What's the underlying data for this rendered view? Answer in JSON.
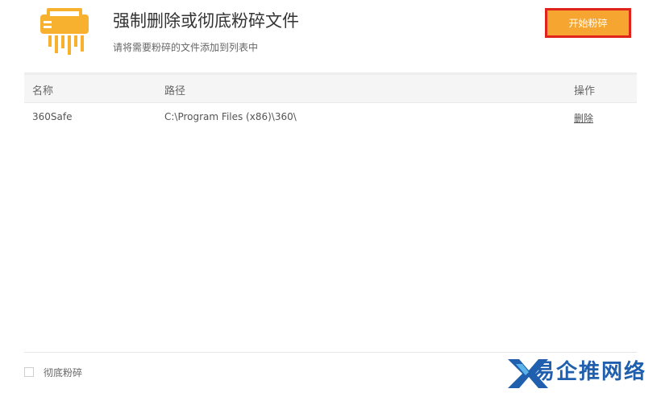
{
  "header": {
    "title": "强制删除或彻底粉碎文件",
    "subtitle": "请将需要粉碎的文件添加到列表中",
    "start_button": "开始粉碎",
    "icon": "shredder-icon"
  },
  "table": {
    "columns": [
      "名称",
      "路径",
      "操作"
    ],
    "rows": [
      {
        "name": "360Safe",
        "path": "C:\\Program Files (x86)\\360\\",
        "action": "删除"
      }
    ]
  },
  "footer": {
    "checkbox_label": "彻底粉碎",
    "checkbox_checked": false
  },
  "watermark": {
    "text": "易企推网络",
    "icon": "watermark-logo-icon"
  },
  "colors": {
    "accent": "#f7a531",
    "button_border": "#e0241c",
    "icon": "#f7b12f",
    "watermark": "#1f5fae"
  }
}
